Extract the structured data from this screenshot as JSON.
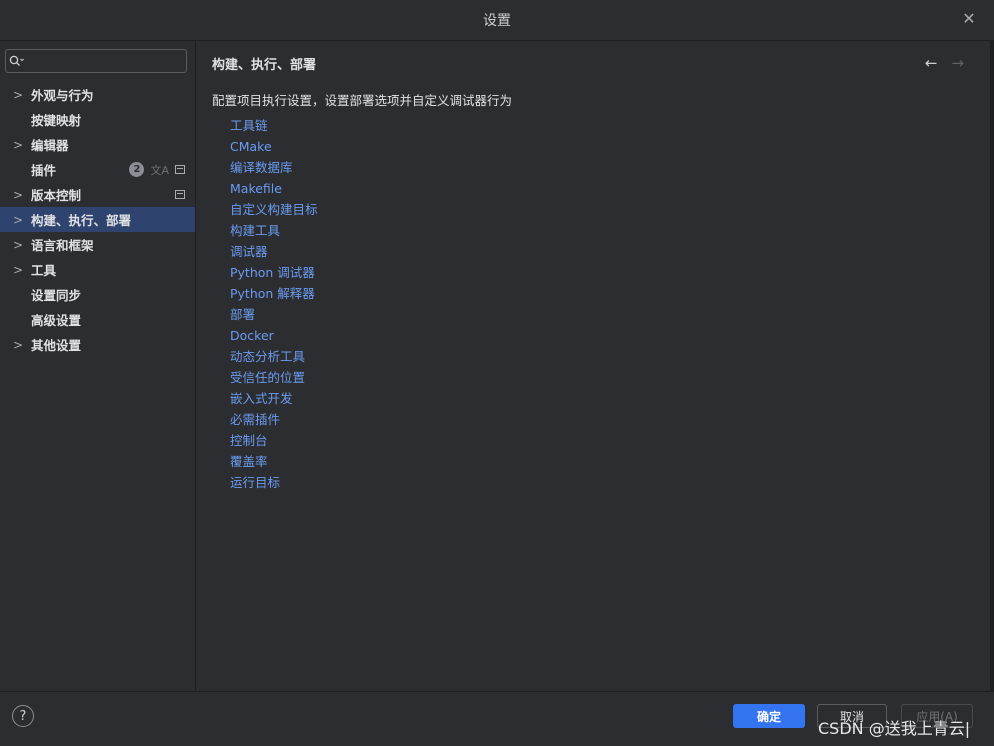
{
  "window": {
    "title": "设置"
  },
  "search": {
    "placeholder": "",
    "value": ""
  },
  "sidebar": {
    "items": [
      {
        "label": "外观与行为",
        "expandable": true
      },
      {
        "label": "按键映射",
        "expandable": false
      },
      {
        "label": "编辑器",
        "expandable": true
      },
      {
        "label": "插件",
        "expandable": false,
        "badge": "2"
      },
      {
        "label": "版本控制",
        "expandable": true
      },
      {
        "label": "构建、执行、部署",
        "expandable": true,
        "selected": true
      },
      {
        "label": "语言和框架",
        "expandable": true
      },
      {
        "label": "工具",
        "expandable": true
      },
      {
        "label": "设置同步",
        "expandable": false
      },
      {
        "label": "高级设置",
        "expandable": false
      },
      {
        "label": "其他设置",
        "expandable": true
      }
    ]
  },
  "main": {
    "title": "构建、执行、部署",
    "description": "配置项目执行设置，设置部署选项并自定义调试器行为",
    "links": [
      "工具链",
      "CMake",
      "编译数据库",
      "Makefile",
      "自定义构建目标",
      "构建工具",
      "调试器",
      "Python 调试器",
      "Python 解释器",
      "部署",
      "Docker",
      "动态分析工具",
      "受信任的位置",
      "嵌入式开发",
      "必需插件",
      "控制台",
      "覆盖率",
      "运行目标"
    ]
  },
  "footer": {
    "help": "?",
    "ok_label": "确定",
    "cancel_label": "取消",
    "apply_label": "应用(A)"
  },
  "watermark": "CSDN @送我上青云|",
  "colors": {
    "accent": "#3574f0",
    "link": "#6b9bf0",
    "selected": "#2e436e",
    "background": "#2b2d30"
  }
}
